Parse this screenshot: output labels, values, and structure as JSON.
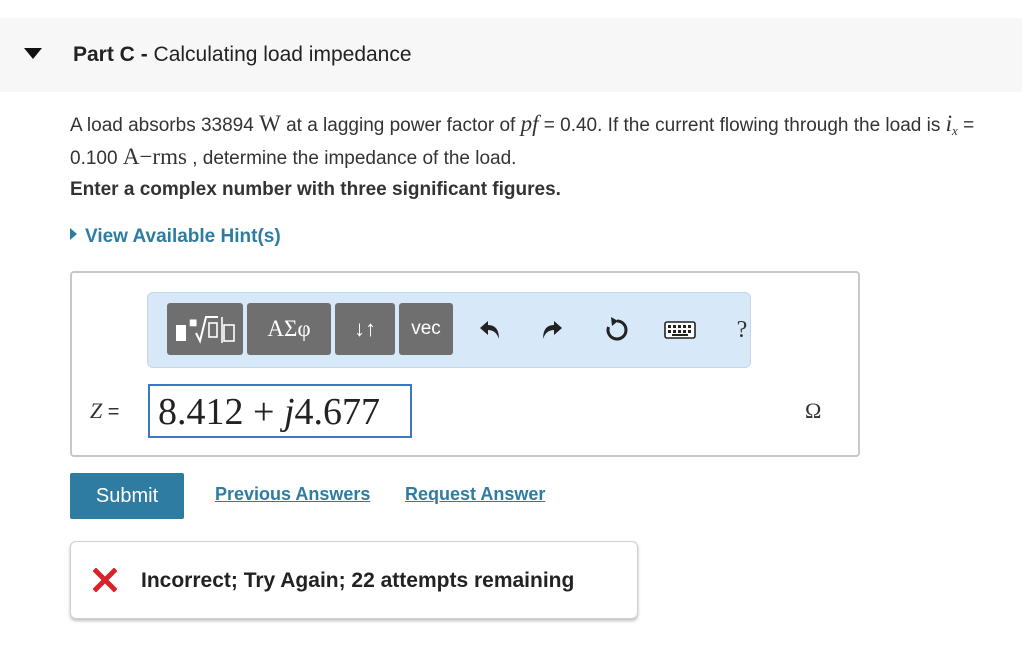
{
  "header": {
    "part_label": "Part C",
    "separator": " - ",
    "part_title": "Calculating load impedance"
  },
  "problem": {
    "t1": "A load absorbs 33894 ",
    "power_unit": "W",
    "t2": " at a lagging power factor of ",
    "pf_symbol": "pf",
    "t3": " = 0.40. If the current flowing through the load is ",
    "current_symbol": "i",
    "current_sub": "x",
    "t4": " = 0.100 ",
    "current_unit": "A−rms",
    "t5": " , determine the impedance of the load."
  },
  "instructions": "Enter a complex number with three significant figures.",
  "hint_link": "View Available Hint(s)",
  "toolbar": {
    "templates_icon": "templates-icon",
    "greek_label": "ΑΣφ",
    "arrows_label": "↓↑",
    "vec_label": "vec",
    "help_label": "?"
  },
  "answer": {
    "variable": "Z",
    "equals": " =",
    "real_part": "8.412 + ",
    "j_symbol": "j",
    "imag_part": "4.677",
    "unit": "Ω"
  },
  "actions": {
    "submit": "Submit",
    "previous_answers": "Previous Answers",
    "request_answer": "Request Answer"
  },
  "feedback": {
    "message": "Incorrect; Try Again; 22 attempts remaining"
  },
  "colors": {
    "link": "#2e7ca1",
    "submit_bg": "#2e7ca1",
    "toolbar_bg": "#d7e8f9",
    "tool_button": "#6f6f6f",
    "input_border": "#3a77c5",
    "error": "#d9232b"
  }
}
